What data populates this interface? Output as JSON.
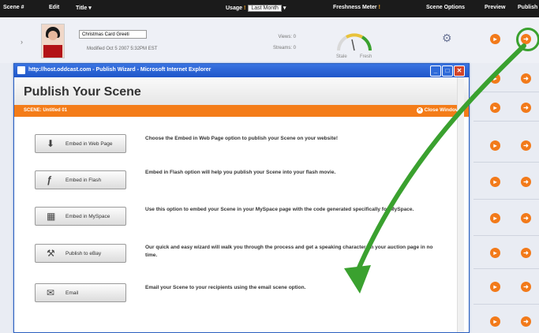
{
  "header": {
    "columns": [
      "Scene #",
      "Edit",
      "Title ▾",
      "Usage",
      "Freshness Meter",
      "Scene Options",
      "Preview",
      "Publish"
    ],
    "usage_select": "Last Month"
  },
  "row": {
    "expand": "›",
    "title_value": "Christmas Card Greeti",
    "modified": "Modified Oct 5 2007 5:32PM EST",
    "stats": [
      "Views: 0",
      "Streams: 0"
    ],
    "gauge_left": "Stale",
    "gauge_right": "Fresh"
  },
  "dialog": {
    "window_title": "http://host.oddcast.com - Publish Wizard - Microsoft Internet Explorer",
    "heading": "Publish Your Scene",
    "scene_label": "SCENE: Untitled 01",
    "close_label": "Close Window",
    "options": [
      {
        "label": "Embed in Web Page",
        "icon": "download-arrow-icon",
        "glyph": "⬇",
        "description": "Choose the Embed in Web Page option to publish your Scene on your website!"
      },
      {
        "label": "Embed in Flash",
        "icon": "flash-icon",
        "glyph": "ƒ",
        "description": "Embed in Flash option will help you publish your Scene into your flash movie."
      },
      {
        "label": "Embed in MySpace",
        "icon": "myspace-icon",
        "glyph": "▦",
        "description": "Use this option to embed your Scene in your MySpace page with the code generated specifically for MySpace."
      },
      {
        "label": "Publish to eBay",
        "icon": "hammer-icon",
        "glyph": "⚒",
        "description": "Our quick and easy wizard will walk you through the process and get a speaking character on your auction page in no time."
      },
      {
        "label": "Email",
        "icon": "envelope-icon",
        "glyph": "✉",
        "description": "Email your Scene to your recipients using the email scene option."
      }
    ]
  },
  "colors": {
    "orange": "#f47c18",
    "titlebar_blue": "#1f56c9",
    "highlight_green": "#3aa12f"
  }
}
